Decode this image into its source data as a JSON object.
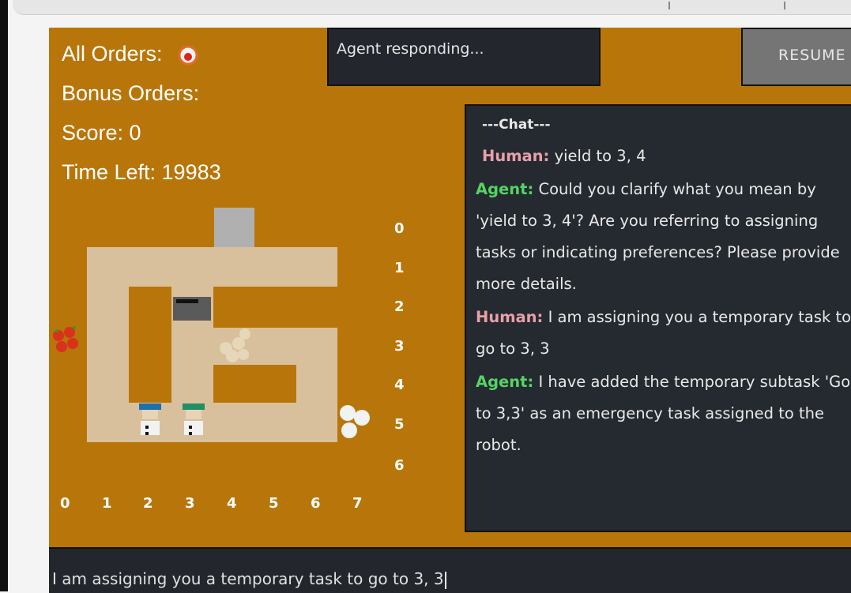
{
  "hud": {
    "all_orders_label": "All Orders:",
    "bonus_orders_label": "Bonus Orders:",
    "score_label": "Score: 0",
    "time_left_label": "Time Left: 19983"
  },
  "status": {
    "agent_text": "Agent responding..."
  },
  "controls": {
    "resume_label": "RESUME"
  },
  "chat": {
    "title": "---Chat---",
    "messages": [
      {
        "speaker": "Human:",
        "text": "yield to 3, 4"
      },
      {
        "speaker": "Agent:",
        "text": "Could you clarify what you mean by 'yield to 3, 4'? Are you referring to assigning tasks or indicating preferences? Please provide more details."
      },
      {
        "speaker": "Human:",
        "text": "I am assigning you a temporary task to go to 3, 3"
      },
      {
        "speaker": "Agent:",
        "text": "I have added the temporary subtask 'Go to 3,3' as an emergency task assigned to the robot."
      }
    ]
  },
  "grid": {
    "x_labels": [
      "0",
      "1",
      "2",
      "3",
      "4",
      "5",
      "6",
      "7"
    ],
    "y_labels": [
      "0",
      "1",
      "2",
      "3",
      "4",
      "5",
      "6"
    ]
  },
  "input": {
    "value": "I am assigning you a temporary task to go to 3, 3"
  },
  "colors": {
    "background": "#b8760a",
    "floor": "#d8c09c",
    "chat_bg": "#252a30"
  }
}
